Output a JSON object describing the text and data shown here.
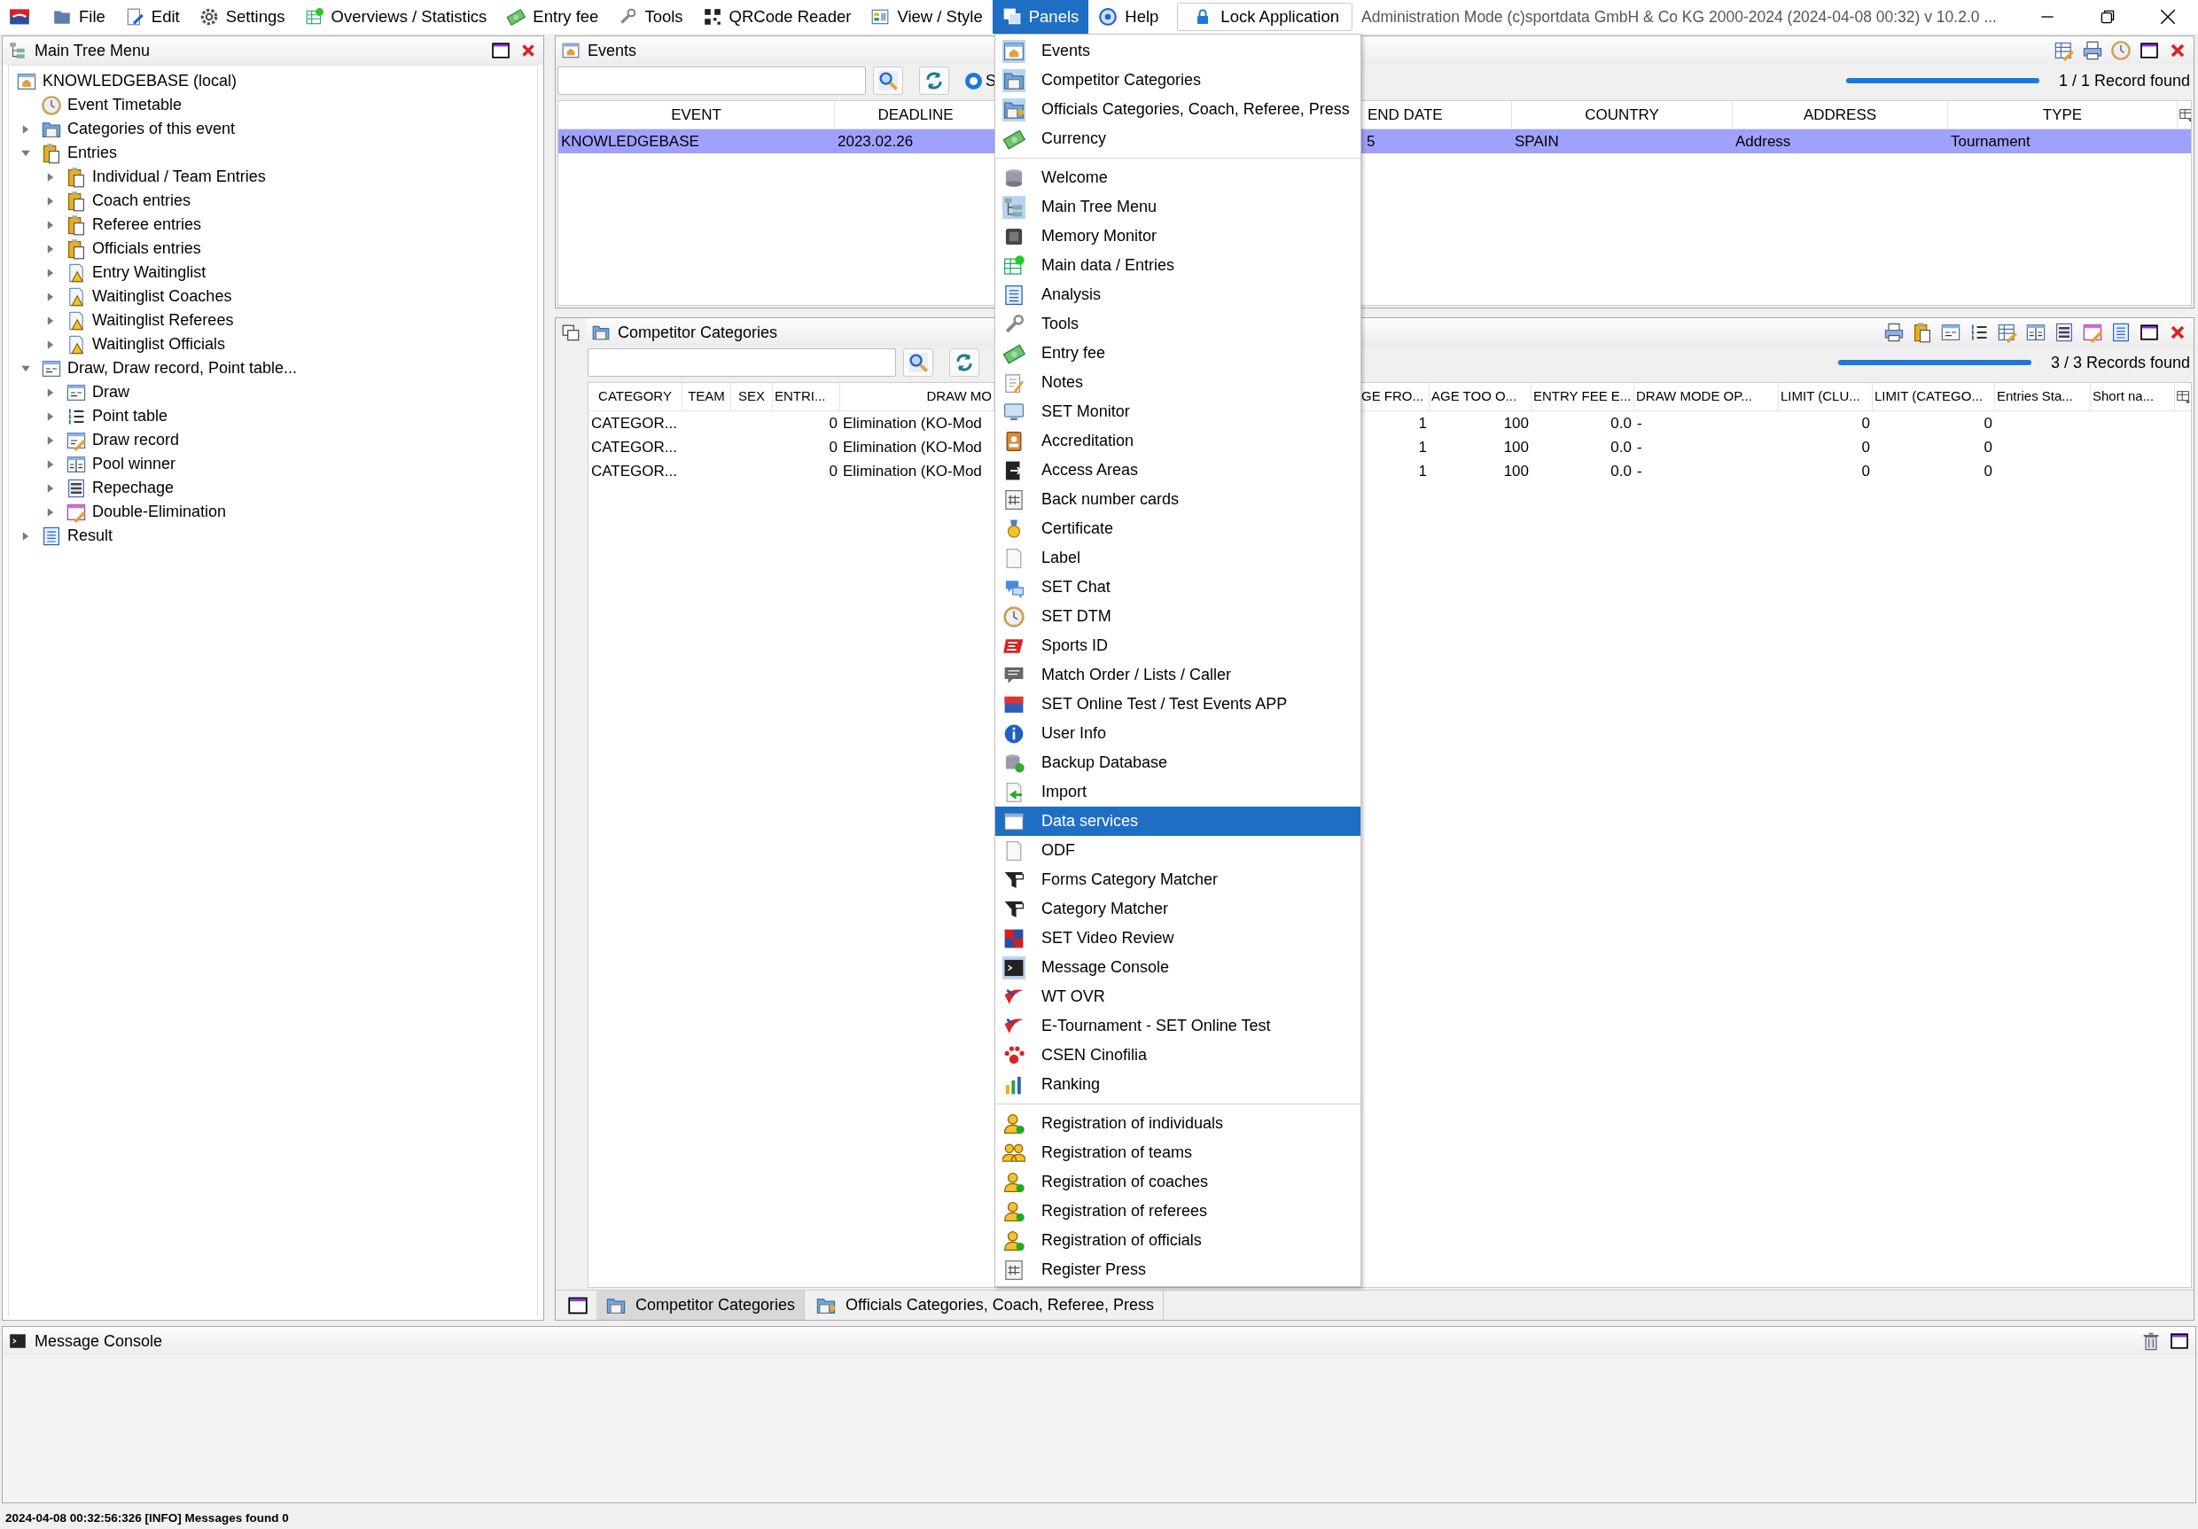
{
  "menubar": {
    "items": [
      {
        "label": "File",
        "selected": false
      },
      {
        "label": "Edit",
        "selected": false
      },
      {
        "label": "Settings",
        "selected": false
      },
      {
        "label": "Overviews / Statistics",
        "selected": false
      },
      {
        "label": "Entry fee",
        "selected": false
      },
      {
        "label": "Tools",
        "selected": false
      },
      {
        "label": "QRCode Reader",
        "selected": false
      },
      {
        "label": "View / Style",
        "selected": false
      },
      {
        "label": "Panels",
        "selected": true
      },
      {
        "label": "Help",
        "selected": false
      }
    ],
    "lock_button": "Lock Application",
    "title": "Administration Mode (c)sportdata GmbH & Co KG 2000-2024 (2024-04-08 00:32)  v 10.2.0 ..."
  },
  "tree_panel": {
    "title": "Main Tree Menu",
    "tree": {
      "label": "KNOWLEDGEBASE (local)",
      "children": [
        {
          "label": "Event Timetable"
        },
        {
          "label": "Categories of this event",
          "expanded": false
        },
        {
          "label": "Entries",
          "expanded": true,
          "children": [
            {
              "label": "Individual / Team Entries",
              "expanded": false
            },
            {
              "label": "Coach entries",
              "expanded": false
            },
            {
              "label": "Referee entries",
              "expanded": false
            },
            {
              "label": "Officials entries",
              "expanded": false
            },
            {
              "label": "Entry Waitinglist",
              "expanded": false
            },
            {
              "label": "Waitinglist Coaches",
              "expanded": false
            },
            {
              "label": "Waitinglist Referees",
              "expanded": false
            },
            {
              "label": "Waitinglist Officials",
              "expanded": false
            }
          ]
        },
        {
          "label": "Draw, Draw record, Point table...",
          "expanded": true,
          "children": [
            {
              "label": "Draw",
              "expanded": false
            },
            {
              "label": "Point table",
              "expanded": false
            },
            {
              "label": "Draw record",
              "expanded": false
            },
            {
              "label": "Pool winner",
              "expanded": false
            },
            {
              "label": "Repechage",
              "expanded": false
            },
            {
              "label": "Double-Elimination",
              "expanded": false
            }
          ]
        },
        {
          "label": "Result",
          "expanded": false
        }
      ]
    }
  },
  "events_panel": {
    "title": "Events",
    "radio": {
      "label": "S",
      "selected": true
    },
    "progress": {
      "level": 1
    },
    "count": "1 / 1 Record found",
    "table": {
      "columns": [
        "EVENT",
        "DEADLINE",
        "END DATE",
        "COUNTRY",
        "ADDRESS",
        "TYPE"
      ],
      "rows": [
        {
          "selected": true,
          "cells": [
            "KNOWLEDGEBASE",
            "2023.02.26",
            "5",
            "SPAIN",
            "Address",
            "Tournament"
          ]
        }
      ]
    }
  },
  "categories_panel": {
    "title": "Competitor Categories",
    "progress": {
      "level": 1
    },
    "count": "3 / 3 Records found",
    "table": {
      "columns": [
        "CATEGORY",
        "TEAM",
        "SEX",
        "ENTRI...",
        "DRAW MO",
        "GE FRO...",
        "AGE TOO O...",
        "ENTRY FEE E...",
        "DRAW MODE OP...",
        "LIMIT (CLU...",
        "LIMIT (CATEGO...",
        "Entries Sta...",
        "Short na..."
      ],
      "rows": [
        {
          "selected": false,
          "cells": [
            "CATEGOR...",
            null,
            null,
            "0",
            "Elimination (KO-Mod",
            "1",
            "100",
            "0.0",
            "-",
            "0",
            "0",
            null,
            null
          ]
        },
        {
          "selected": false,
          "cells": [
            "CATEGOR...",
            null,
            null,
            "0",
            "Elimination (KO-Mod",
            "1",
            "100",
            "0.0",
            "-",
            "0",
            "0",
            null,
            null
          ]
        },
        {
          "selected": false,
          "cells": [
            "CATEGOR...",
            null,
            null,
            "0",
            "Elimination (KO-Mod",
            "1",
            "100",
            "0.0",
            "-",
            "0",
            "0",
            null,
            null
          ]
        }
      ]
    },
    "tabs": [
      {
        "label": "Competitor Categories",
        "selected": true
      },
      {
        "label": "Officials Categories, Coach, Referee, Press",
        "selected": false
      }
    ]
  },
  "panels_menu": {
    "groups": [
      {
        "items": [
          {
            "label": "Events",
            "checked": true,
            "selected": false
          },
          {
            "label": "Competitor Categories",
            "checked": true,
            "selected": false
          },
          {
            "label": "Officials Categories, Coach, Referee, Press",
            "checked": true,
            "selected": false
          },
          {
            "label": "Currency",
            "checked": false,
            "selected": false
          }
        ]
      },
      {
        "items": [
          {
            "label": "Welcome",
            "checked": false,
            "selected": false
          },
          {
            "label": "Main Tree Menu",
            "checked": true,
            "selected": false
          },
          {
            "label": "Memory Monitor",
            "checked": false,
            "selected": false
          },
          {
            "label": "Main data / Entries",
            "checked": false,
            "selected": false
          },
          {
            "label": "Analysis",
            "checked": false,
            "selected": false
          },
          {
            "label": "Tools",
            "checked": false,
            "selected": false
          },
          {
            "label": "Entry fee",
            "checked": false,
            "selected": false
          },
          {
            "label": "Notes",
            "checked": false,
            "selected": false
          },
          {
            "label": "SET Monitor",
            "checked": false,
            "selected": false
          },
          {
            "label": "Accreditation",
            "checked": false,
            "selected": false
          },
          {
            "label": "Access Areas",
            "checked": false,
            "selected": false
          },
          {
            "label": "Back number cards",
            "checked": false,
            "selected": false
          },
          {
            "label": "Certificate",
            "checked": false,
            "selected": false
          },
          {
            "label": "Label",
            "checked": false,
            "selected": false
          },
          {
            "label": "SET Chat",
            "checked": false,
            "selected": false
          },
          {
            "label": "SET DTM",
            "checked": false,
            "selected": false
          },
          {
            "label": "Sports ID",
            "checked": false,
            "selected": false
          },
          {
            "label": "Match Order / Lists / Caller",
            "checked": false,
            "selected": false
          },
          {
            "label": "SET Online Test / Test Events APP",
            "checked": false,
            "selected": false
          },
          {
            "label": "User Info",
            "checked": false,
            "selected": false
          },
          {
            "label": "Backup Database",
            "checked": false,
            "selected": false
          },
          {
            "label": "Import",
            "checked": false,
            "selected": false
          },
          {
            "label": "Data services",
            "checked": false,
            "selected": true
          },
          {
            "label": "ODF",
            "checked": false,
            "selected": false
          },
          {
            "label": "Forms Category Matcher",
            "checked": false,
            "selected": false
          },
          {
            "label": "Category Matcher",
            "checked": false,
            "selected": false
          },
          {
            "label": "SET Video Review",
            "checked": false,
            "selected": false
          },
          {
            "label": "Message Console",
            "checked": true,
            "selected": false
          },
          {
            "label": "WT OVR",
            "checked": false,
            "selected": false
          },
          {
            "label": "E-Tournament - SET Online Test",
            "checked": false,
            "selected": false
          },
          {
            "label": "CSEN Cinofilia",
            "checked": false,
            "selected": false
          },
          {
            "label": "Ranking",
            "checked": false,
            "selected": false
          }
        ]
      },
      {
        "items": [
          {
            "label": "Registration of individuals",
            "checked": false,
            "selected": false
          },
          {
            "label": "Registration of teams",
            "checked": false,
            "selected": false
          },
          {
            "label": "Registration of coaches",
            "checked": false,
            "selected": false
          },
          {
            "label": "Registration of referees",
            "checked": false,
            "selected": false
          },
          {
            "label": "Registration of officials",
            "checked": false,
            "selected": false
          },
          {
            "label": "Register Press",
            "checked": false,
            "selected": false
          }
        ]
      }
    ]
  },
  "console": {
    "title": "Message Console"
  },
  "status_bar": "2024-04-08 00:32:56:326 [INFO] Messages found 0"
}
